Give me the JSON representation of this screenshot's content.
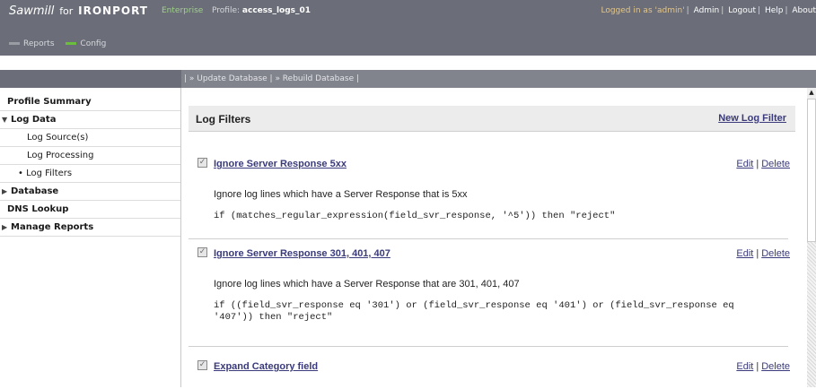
{
  "header": {
    "brand_sawmill": "Sawmill",
    "brand_for": "for",
    "brand_ironport": "IRONPORT",
    "edition": "Enterprise",
    "profile_label": "Profile:",
    "profile_name": "access_logs_01",
    "logged_in": "Logged in as 'admin'",
    "links": [
      "Admin",
      "Logout",
      "Help",
      "About"
    ],
    "nav": [
      {
        "label": "Reports",
        "color": "#9a9ca4"
      },
      {
        "label": "Config",
        "color": "#6bbd3e"
      }
    ]
  },
  "actions": {
    "update": "» Update Database",
    "rebuild": "» Rebuild Database"
  },
  "sidebar": {
    "items": [
      {
        "label": "Profile Summary"
      },
      {
        "label": "Log Data",
        "caret": "▼"
      },
      {
        "label": "Log Source(s)"
      },
      {
        "label": "Log Processing"
      },
      {
        "label": "Log Filters",
        "bullet": "•"
      },
      {
        "label": "Database",
        "caret": "▶"
      },
      {
        "label": "DNS Lookup"
      },
      {
        "label": "Manage Reports",
        "caret": "▶"
      }
    ]
  },
  "main": {
    "title": "Log Filters",
    "new_filter": "New Log Filter",
    "edit": "Edit",
    "delete": "Delete",
    "filters": [
      {
        "name": "Ignore Server Response 5xx",
        "description": "Ignore log lines which have a Server Response that is 5xx",
        "expression": "if (matches_regular_expression(field_svr_response, '^5')) then \"reject\""
      },
      {
        "name": "Ignore Server Response 301, 401, 407",
        "description": "Ignore log lines which have a Server Response that are 301, 401, 407",
        "expression": "if ((field_svr_response eq '301') or (field_svr_response eq '401') or (field_svr_response eq '407')) then \"reject\""
      },
      {
        "name": "Expand Category field"
      }
    ]
  }
}
